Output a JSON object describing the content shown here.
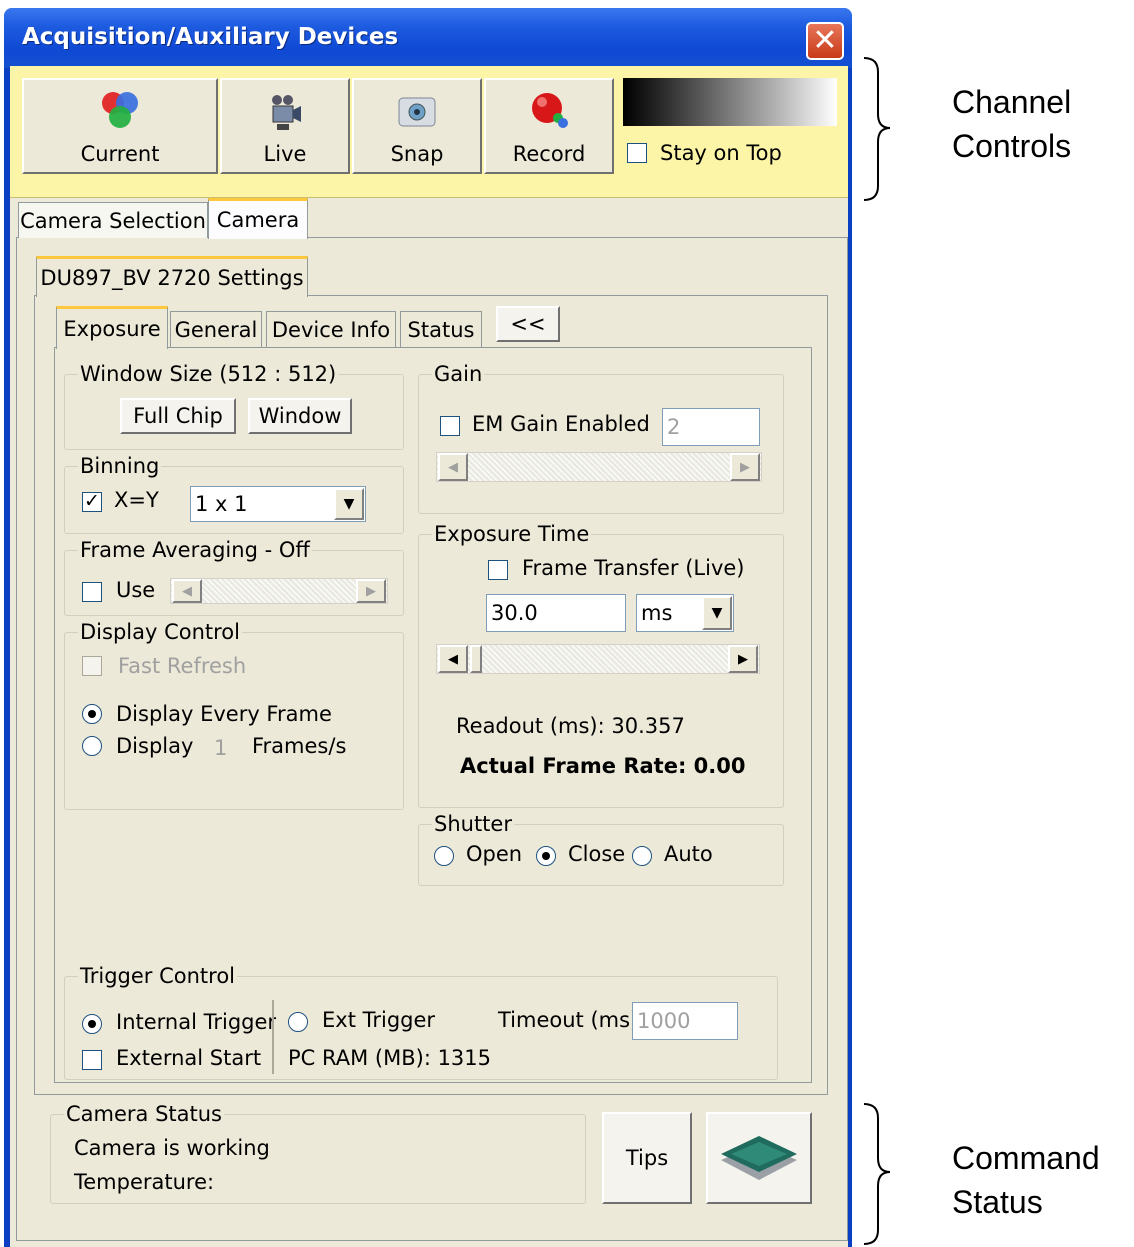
{
  "window": {
    "title": "Acquisition/Auxiliary Devices",
    "close_symbol": "✕"
  },
  "channel_controls": {
    "buttons": [
      {
        "label": "Current",
        "icon": "rgb-circles-icon"
      },
      {
        "label": "Live",
        "icon": "video-camera-icon"
      },
      {
        "label": "Snap",
        "icon": "photo-camera-icon"
      },
      {
        "label": "Record",
        "icon": "record-icon"
      }
    ],
    "stay_on_top": {
      "label": "Stay on Top",
      "checked": false
    }
  },
  "top_tabs": [
    "Camera Selection",
    "Camera"
  ],
  "settings_tab": "DU897_BV 2720 Settings",
  "sub_tabs": [
    "Exposure",
    "General",
    "Device Info",
    "Status",
    "<<"
  ],
  "window_size": {
    "label": "Window Size (512 : 512)",
    "full_chip": "Full Chip",
    "window": "Window"
  },
  "binning": {
    "label": "Binning",
    "xy_label": "X=Y",
    "xy_checked": true,
    "value": "1 x 1"
  },
  "frame_averaging": {
    "label": "Frame Averaging - Off",
    "use_label": "Use",
    "use_checked": false
  },
  "display_control": {
    "label": "Display Control",
    "fast_refresh": "Fast Refresh",
    "every_frame": "Display Every Frame",
    "display": "Display",
    "fps_value": "1",
    "fps_unit": "Frames/s"
  },
  "gain": {
    "label": "Gain",
    "em_label": "EM Gain Enabled",
    "em_checked": false,
    "value": "2"
  },
  "exposure_time": {
    "label": "Exposure Time",
    "frame_transfer": "Frame Transfer (Live)",
    "value": "30.0",
    "unit": "ms",
    "readout": "Readout (ms): 30.357",
    "frame_rate": "Actual Frame Rate: 0.00"
  },
  "shutter": {
    "label": "Shutter",
    "open": "Open",
    "close": "Close",
    "auto": "Auto",
    "selected": "Close"
  },
  "trigger": {
    "label": "Trigger Control",
    "internal": "Internal Trigger",
    "external_start": "External Start",
    "ext": "Ext Trigger",
    "timeout_label": "Timeout (ms)",
    "timeout_value": "1000",
    "pc_ram": "PC RAM (MB): 1315"
  },
  "camera_status": {
    "label": "Camera Status",
    "line1": "Camera is working",
    "line2": "Temperature:"
  },
  "tips": "Tips",
  "annotations": {
    "channel_1": "Channel",
    "channel_2": "Controls",
    "command_1": "Command",
    "command_2": "Status"
  }
}
